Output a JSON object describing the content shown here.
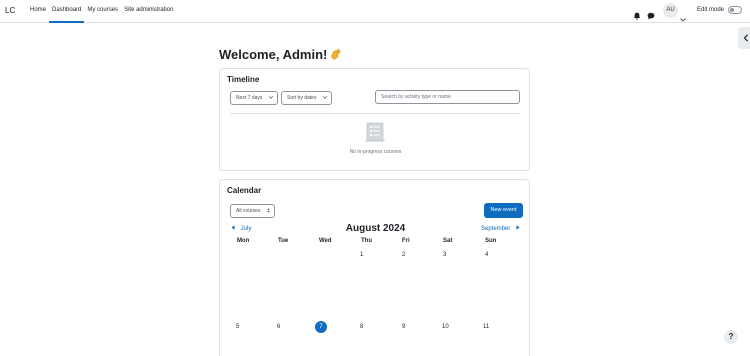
{
  "brand": "LC",
  "nav": {
    "items": [
      {
        "label": "Home"
      },
      {
        "label": "Dashboard"
      },
      {
        "label": "My courses"
      },
      {
        "label": "Site administration"
      }
    ]
  },
  "user": {
    "initials": "AU"
  },
  "edit_mode": {
    "label": "Edit mode",
    "on": false
  },
  "welcome": "Welcome, Admin!",
  "timeline": {
    "title": "Timeline",
    "range_filter": "Next 7 days",
    "sort_filter": "Sort by dates",
    "search_placeholder": "Search by activity type or name",
    "empty_message": "No in-progress courses"
  },
  "calendar": {
    "title": "Calendar",
    "course_filter": "All courses",
    "new_event_label": "New event",
    "prev_month": "July",
    "next_month": "September",
    "month_title": "August 2024",
    "weekdays": [
      "Mon",
      "Tue",
      "Wed",
      "Thu",
      "Fri",
      "Sat",
      "Sun"
    ],
    "week1": [
      "",
      "",
      "",
      "1",
      "2",
      "3",
      "4"
    ],
    "week2": [
      "5",
      "6",
      "7",
      "8",
      "9",
      "10",
      "11"
    ],
    "today": "7"
  },
  "help_label": "?",
  "colors": {
    "primary": "#0f6cbf",
    "border": "#dee2e6"
  },
  "icons": [
    "bell-icon",
    "chat-icon",
    "chevron-down-icon",
    "chevron-left-icon",
    "wave-emoji-icon",
    "empty-courses-icon",
    "caret-left-icon",
    "caret-right-icon"
  ]
}
